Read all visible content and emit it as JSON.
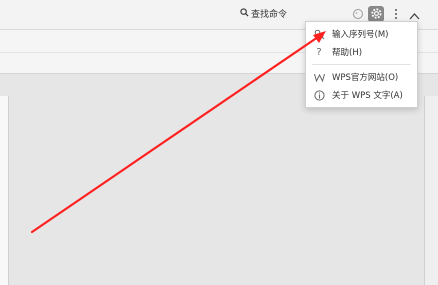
{
  "titlebar": {
    "search_label": "查找命令"
  },
  "icons": {
    "search": "search-icon",
    "skin": "skin-icon",
    "settings": "gear-icon",
    "more": "more-vertical-icon",
    "collapse": "chevron-up-icon"
  },
  "menu": {
    "items": [
      {
        "label": "输入序列号(M)",
        "icon": "key-icon"
      },
      {
        "label": "帮助(H)",
        "icon": "question-icon"
      },
      {
        "label": "WPS官方网站(O)",
        "icon": "wps-logo-icon"
      },
      {
        "label": "关于 WPS 文字(A)",
        "icon": "info-icon"
      }
    ]
  },
  "colors": {
    "annotation_arrow": "#ff2020",
    "gear_bg": "#888888",
    "workspace": "#e6e6e6"
  }
}
